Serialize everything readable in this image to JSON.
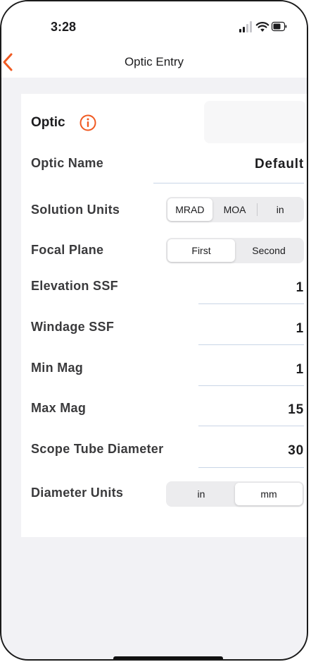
{
  "status_bar": {
    "time": "3:28",
    "icons": [
      "signal-icon",
      "wifi-icon",
      "battery-icon"
    ]
  },
  "nav": {
    "back_icon": "chevron-left-icon",
    "title": "Optic Entry",
    "accent_color": "#f05a22"
  },
  "section": {
    "title": "Optic",
    "info_icon": "info-circle-icon"
  },
  "fields": {
    "optic_name": {
      "label": "Optic Name",
      "value": "Default"
    },
    "solution_units": {
      "label": "Solution Units",
      "options": [
        "MRAD",
        "MOA",
        "in"
      ],
      "selected": "MRAD"
    },
    "focal_plane": {
      "label": "Focal Plane",
      "options": [
        "First",
        "Second"
      ],
      "selected": "First"
    },
    "elevation_ssf": {
      "label": "Elevation SSF",
      "value": "1"
    },
    "windage_ssf": {
      "label": "Windage SSF",
      "value": "1"
    },
    "min_mag": {
      "label": "Min Mag",
      "value": "1"
    },
    "max_mag": {
      "label": "Max Mag",
      "value": "15"
    },
    "scope_tube_diameter": {
      "label": "Scope Tube Diameter",
      "value": "30"
    },
    "diameter_units": {
      "label": "Diameter Units",
      "options": [
        "in",
        "mm"
      ],
      "selected": "mm"
    }
  }
}
